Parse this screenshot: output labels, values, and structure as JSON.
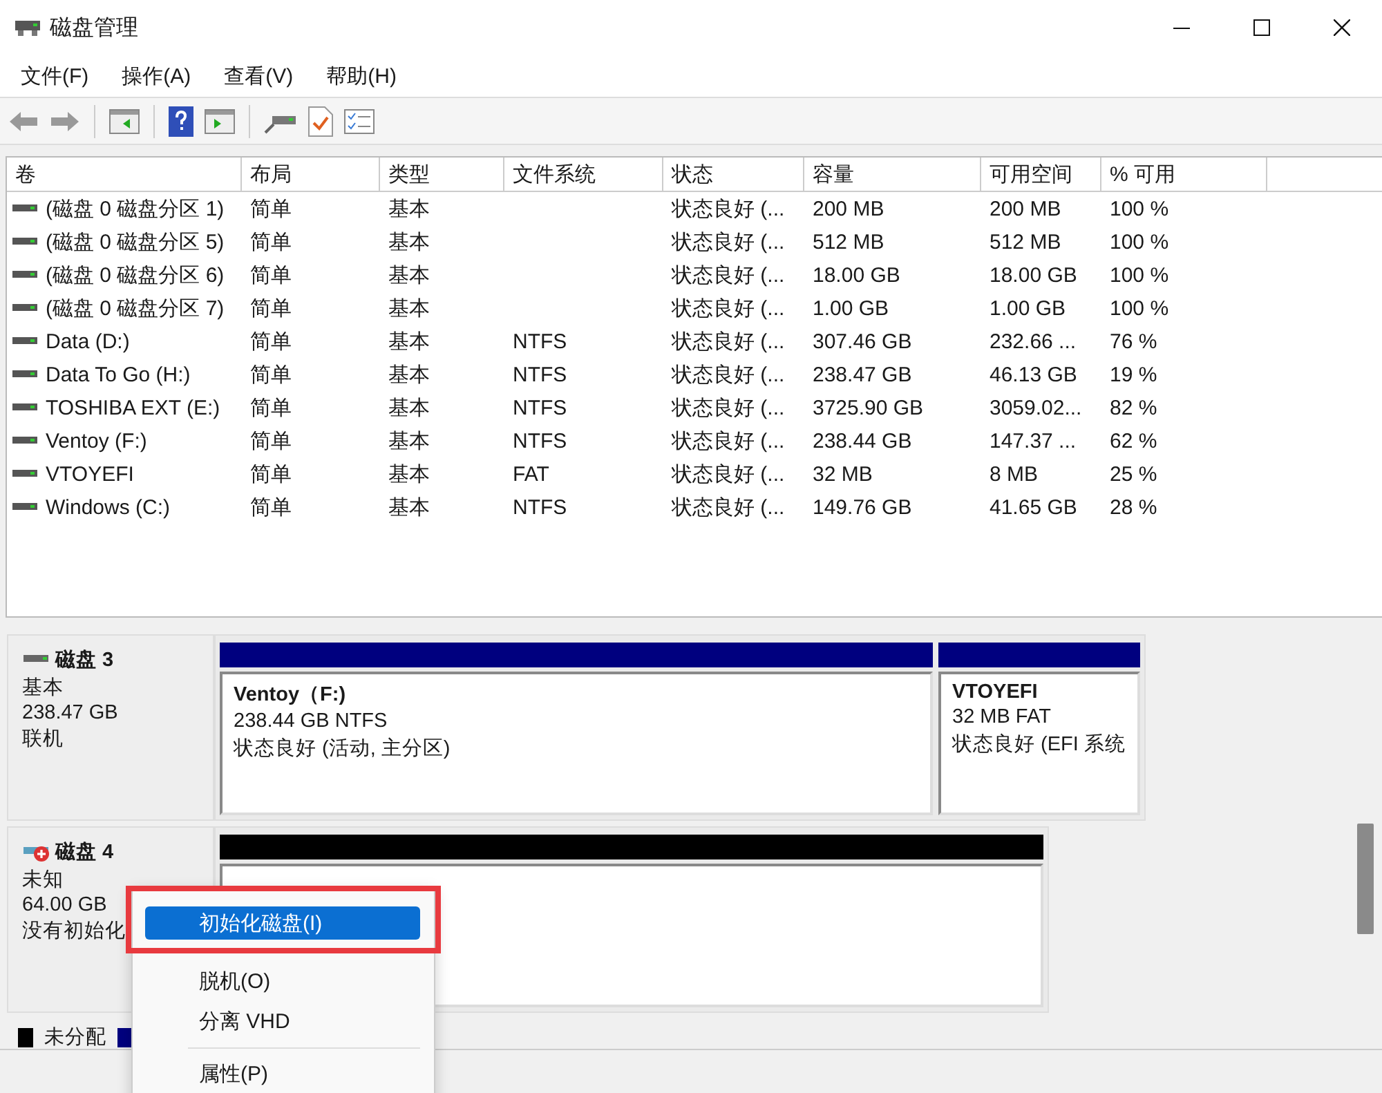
{
  "window": {
    "title": "磁盘管理"
  },
  "menu": [
    "文件(F)",
    "操作(A)",
    "查看(V)",
    "帮助(H)"
  ],
  "volumes": {
    "columns": [
      "卷",
      "布局",
      "类型",
      "文件系统",
      "状态",
      "容量",
      "可用空间",
      "% 可用"
    ],
    "rows": [
      {
        "cells": [
          "(磁盘 0 磁盘分区 1)",
          "简单",
          "基本",
          "",
          "状态良好 (...",
          "200 MB",
          "200 MB",
          "100 %"
        ]
      },
      {
        "cells": [
          "(磁盘 0 磁盘分区 5)",
          "简单",
          "基本",
          "",
          "状态良好 (...",
          "512 MB",
          "512 MB",
          "100 %"
        ]
      },
      {
        "cells": [
          "(磁盘 0 磁盘分区 6)",
          "简单",
          "基本",
          "",
          "状态良好 (...",
          "18.00 GB",
          "18.00 GB",
          "100 %"
        ]
      },
      {
        "cells": [
          "(磁盘 0 磁盘分区 7)",
          "简单",
          "基本",
          "",
          "状态良好 (...",
          "1.00 GB",
          "1.00 GB",
          "100 %"
        ]
      },
      {
        "cells": [
          "Data (D:)",
          "简单",
          "基本",
          "NTFS",
          "状态良好 (...",
          "307.46 GB",
          "232.66 ...",
          "76 %"
        ]
      },
      {
        "cells": [
          "Data To Go (H:)",
          "简单",
          "基本",
          "NTFS",
          "状态良好 (...",
          "238.47 GB",
          "46.13 GB",
          "19 %"
        ]
      },
      {
        "cells": [
          "TOSHIBA EXT (E:)",
          "简单",
          "基本",
          "NTFS",
          "状态良好 (...",
          "3725.90 GB",
          "3059.02...",
          "82 %"
        ]
      },
      {
        "cells": [
          "Ventoy (F:)",
          "简单",
          "基本",
          "NTFS",
          "状态良好 (...",
          "238.44 GB",
          "147.37 ...",
          "62 %"
        ]
      },
      {
        "cells": [
          "VTOYEFI",
          "简单",
          "基本",
          "FAT",
          "状态良好 (...",
          "32 MB",
          "8 MB",
          "25 %"
        ]
      },
      {
        "cells": [
          "Windows (C:)",
          "简单",
          "基本",
          "NTFS",
          "状态良好 (...",
          "149.76 GB",
          "41.65 GB",
          "28 %"
        ]
      }
    ]
  },
  "disks": [
    {
      "name": "磁盘 3",
      "warning": false,
      "type": "基本",
      "size": "238.47 GB",
      "status": "联机",
      "partitions": [
        {
          "kind": "primary",
          "name": "Ventoy（F:)",
          "detail": "238.44 GB NTFS",
          "status": "状态良好 (活动, 主分区)"
        },
        {
          "kind": "primary",
          "name": "VTOYEFI",
          "detail": "32 MB FAT",
          "status": "状态良好 (EFI 系统"
        }
      ]
    },
    {
      "name": "磁盘 4",
      "warning": true,
      "type": "未知",
      "size": "64.00 GB",
      "status": "没有初始化",
      "partitions": [
        {
          "kind": "unallocated"
        }
      ]
    }
  ],
  "legend": [
    {
      "label": "未分配",
      "color": "#000000"
    },
    {
      "color": "#00007f"
    }
  ],
  "context_menu": [
    {
      "kind": "item",
      "label": "初始化磁盘(I)",
      "selected": true
    },
    {
      "kind": "item",
      "label": "脱机(O)",
      "selected": false
    },
    {
      "kind": "item",
      "label": "分离 VHD",
      "selected": false
    },
    {
      "kind": "separator"
    },
    {
      "kind": "item",
      "label": "属性(P)",
      "selected": false
    }
  ]
}
